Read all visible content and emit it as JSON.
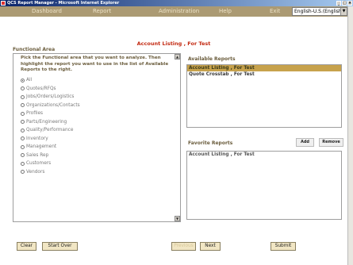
{
  "window": {
    "title": "QCS Report Manager - Microsoft Internet Explorer"
  },
  "nav": {
    "items": [
      "Dashboard",
      "Report",
      "Administration",
      "Help",
      "Exit"
    ],
    "language": "English-U.S.(English"
  },
  "page": {
    "heading": "Account Listing , For Test"
  },
  "functional_area": {
    "title": "Functional Area",
    "instructions": "Pick the Functional area that you want to analyze. Then highlight the report you want to use in the list of Available Reports to the right.",
    "options": [
      "All",
      "Quotes/RFQs",
      "Jobs/Orders/Logistics",
      "Organizations/Contacts",
      "Profiles",
      "Parts/Engineering",
      "Quality/Performance",
      "Inventory",
      "Management",
      "Sales Rep",
      "Customers",
      "Vendors"
    ],
    "selected": "All"
  },
  "available_reports": {
    "title": "Available Reports",
    "items": [
      "Account Listing , For Test",
      "Quote Crosstab , For Test"
    ],
    "selected_index": 0
  },
  "favorite_reports": {
    "title": "Favorite Reports",
    "add_label": "Add",
    "remove_label": "Remove",
    "items": [
      "Account Listing , For Test"
    ]
  },
  "footer": {
    "clear_label": "Clear",
    "start_over_label": "Start Over",
    "previous_label": "Previous",
    "next_label": "Next",
    "submit_label": "Submit"
  },
  "colors": {
    "nav_bg": "#ab9a73",
    "heading_red": "#c32a12",
    "selected_bg": "#c7a24c",
    "button_bg": "#f1e6c4"
  }
}
